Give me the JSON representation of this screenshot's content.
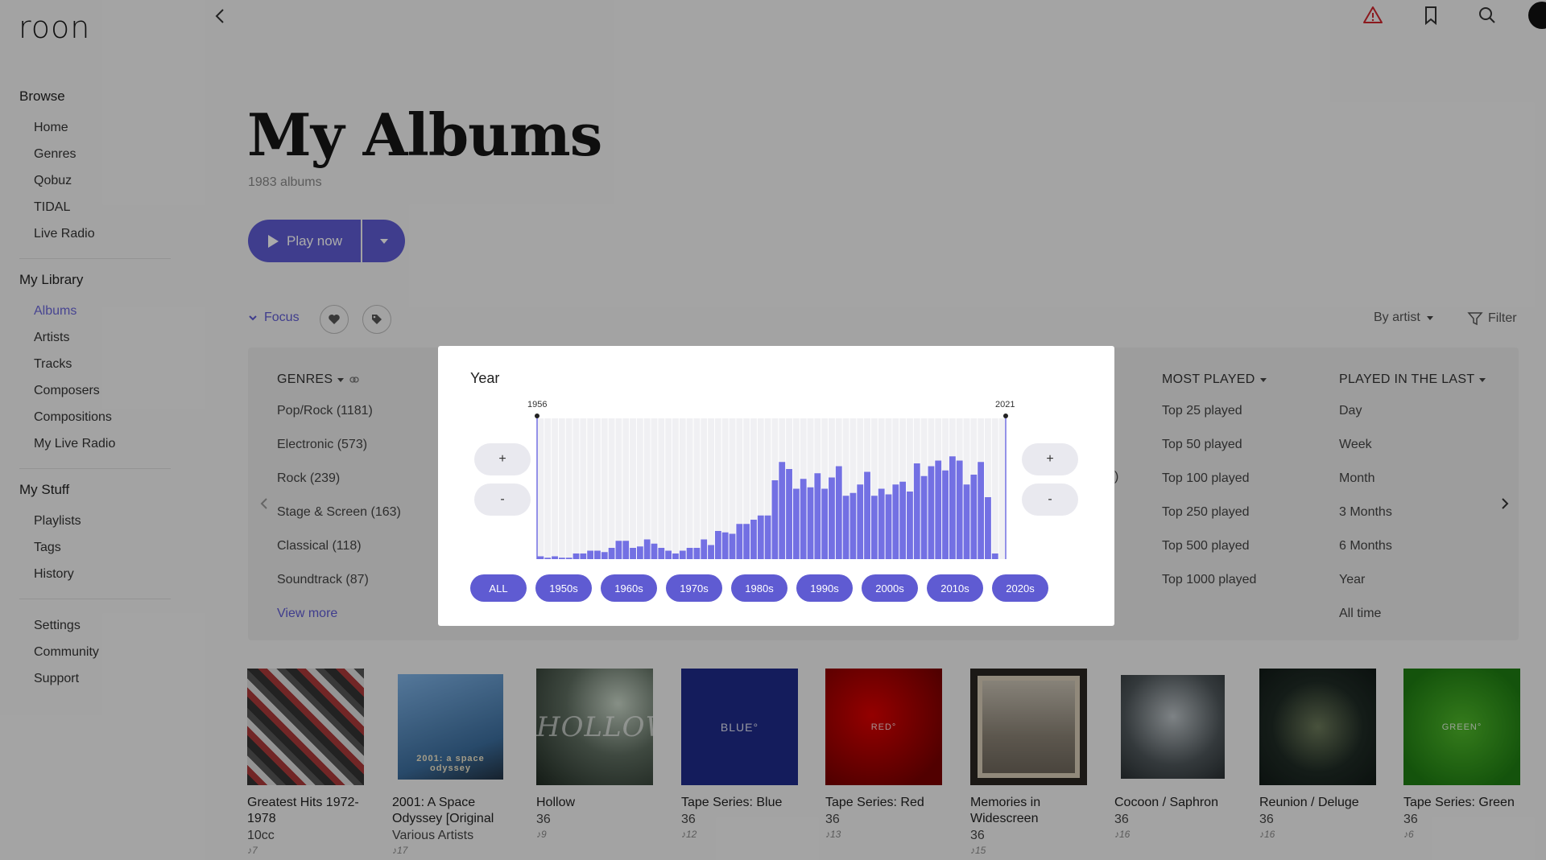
{
  "app": {
    "logo": "roon"
  },
  "topbar": {
    "icons": [
      "back-arrow-icon",
      "warning-icon",
      "bookmark-icon",
      "search-icon"
    ]
  },
  "sidebar": {
    "browse": {
      "title": "Browse",
      "items": [
        "Home",
        "Genres",
        "Qobuz",
        "TIDAL",
        "Live Radio"
      ]
    },
    "library": {
      "title": "My Library",
      "items": [
        "Albums",
        "Artists",
        "Tracks",
        "Composers",
        "Compositions",
        "My Live Radio"
      ],
      "active": "Albums"
    },
    "stuff": {
      "title": "My Stuff",
      "items": [
        "Playlists",
        "Tags",
        "History"
      ]
    },
    "misc": {
      "items": [
        "Settings",
        "Community",
        "Support"
      ]
    }
  },
  "main": {
    "title": "My Albums",
    "subtitle": "1983 albums",
    "play_label": "Play now",
    "focus_label": "Focus",
    "sort_label": "By artist",
    "filter_label": "Filter"
  },
  "focus_panel": {
    "genres": {
      "title": "GENRES",
      "items": [
        "Pop/Rock (1181)",
        "Electronic (573)",
        "Rock (239)",
        "Stage & Screen (163)",
        "Classical (118)",
        "Soundtrack (87)"
      ],
      "more": "View more"
    },
    "hidden_fragment": ")",
    "most_played": {
      "title": "MOST PLAYED",
      "items": [
        "Top 25 played",
        "Top 50 played",
        "Top 100 played",
        "Top 250 played",
        "Top 500 played",
        "Top 1000 played"
      ]
    },
    "played_in_last": {
      "title": "PLAYED IN THE LAST",
      "items": [
        "Day",
        "Week",
        "Month",
        "3 Months",
        "6 Months",
        "Year",
        "All time"
      ]
    }
  },
  "year_modal": {
    "title": "Year",
    "range_start": "1956",
    "range_end": "2021",
    "zoom_in": "+",
    "zoom_out": "-",
    "decades": [
      "ALL",
      "1950s",
      "1960s",
      "1970s",
      "1980s",
      "1990s",
      "2000s",
      "2010s",
      "2020s"
    ]
  },
  "chart_data": {
    "type": "bar",
    "x": [
      1956,
      1957,
      1958,
      1959,
      1960,
      1961,
      1962,
      1963,
      1964,
      1965,
      1966,
      1967,
      1968,
      1969,
      1970,
      1971,
      1972,
      1973,
      1974,
      1975,
      1976,
      1977,
      1978,
      1979,
      1980,
      1981,
      1982,
      1983,
      1984,
      1985,
      1986,
      1987,
      1988,
      1989,
      1990,
      1991,
      1992,
      1993,
      1994,
      1995,
      1996,
      1997,
      1998,
      1999,
      2000,
      2001,
      2002,
      2003,
      2004,
      2005,
      2006,
      2007,
      2008,
      2009,
      2010,
      2011,
      2012,
      2013,
      2014,
      2015,
      2016,
      2017,
      2018,
      2019,
      2020,
      2021
    ],
    "values": [
      2,
      1,
      2,
      1,
      1,
      4,
      4,
      6,
      6,
      5,
      8,
      13,
      13,
      8,
      9,
      14,
      11,
      8,
      6,
      4,
      6,
      8,
      8,
      14,
      10,
      20,
      19,
      18,
      25,
      25,
      28,
      31,
      31,
      56,
      69,
      64,
      50,
      57,
      51,
      61,
      50,
      58,
      66,
      45,
      47,
      53,
      62,
      45,
      50,
      46,
      53,
      55,
      48,
      68,
      59,
      66,
      70,
      63,
      73,
      70,
      53,
      60,
      69,
      44,
      4
    ],
    "ylim": [
      0,
      100
    ],
    "colors": {
      "bar": "#7370e3",
      "bg_stripe": "#f0f0f3"
    }
  },
  "albums": [
    {
      "title": "Greatest Hits 1972-1978",
      "artist": "10cc",
      "tracks": "7",
      "cover_text": ""
    },
    {
      "title": "2001: A Space Odyssey [Original",
      "artist": "Various Artists",
      "tracks": "17",
      "cover_text": "2001: a space odyssey"
    },
    {
      "title": "Hollow",
      "artist": "36",
      "tracks": "9",
      "cover_text": "HOLLOW"
    },
    {
      "title": "Tape Series: Blue",
      "artist": "36",
      "tracks": "12",
      "cover_text": "BLUE°"
    },
    {
      "title": "Tape Series: Red",
      "artist": "36",
      "tracks": "13",
      "cover_text": "RED°"
    },
    {
      "title": "Memories in Widescreen",
      "artist": "36",
      "tracks": "15",
      "cover_text": ""
    },
    {
      "title": "Cocoon / Saphron",
      "artist": "36",
      "tracks": "16",
      "cover_text": ""
    },
    {
      "title": "Reunion / Deluge",
      "artist": "36",
      "tracks": "16",
      "cover_text": ""
    },
    {
      "title": "Tape Series: Green",
      "artist": "36",
      "tracks": "6",
      "cover_text": "GREEN°"
    }
  ]
}
